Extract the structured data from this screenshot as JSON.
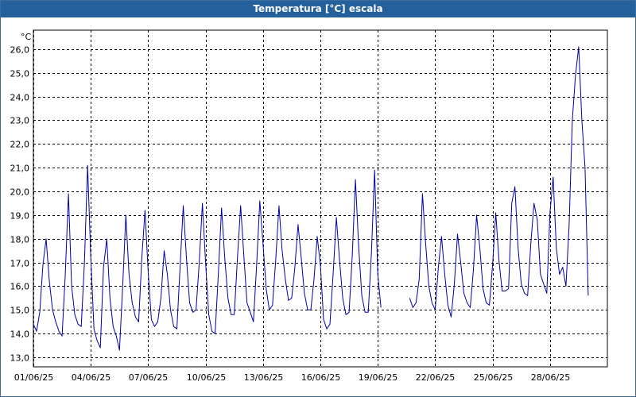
{
  "window": {
    "title": "Temperatura [°C] escala"
  },
  "colors": {
    "titlebar": "#24609b",
    "series": "#0000a8",
    "grid": "#000000"
  },
  "chart_data": {
    "type": "line",
    "title": "Temperatura [°C] escala",
    "ylabel": "°C",
    "xlabel": "",
    "ylim": [
      12.6,
      26.8
    ],
    "yticks": [
      "13,0",
      "14,0",
      "15,0",
      "16,0",
      "17,0",
      "18,0",
      "19,0",
      "20,0",
      "21,0",
      "22,0",
      "23,0",
      "24,0",
      "25,0",
      "26,0"
    ],
    "ytick_values": [
      13,
      14,
      15,
      16,
      17,
      18,
      19,
      20,
      21,
      22,
      23,
      24,
      25,
      26
    ],
    "xlim": [
      "2025-06-01",
      "2025-07-01"
    ],
    "xticks": [
      "01/06/25",
      "04/06/25",
      "07/06/25",
      "10/06/25",
      "13/06/25",
      "16/06/25",
      "19/06/25",
      "22/06/25",
      "25/06/25",
      "28/06/25"
    ],
    "xtick_dates": [
      "2025-06-01",
      "2025-06-04",
      "2025-06-07",
      "2025-06-10",
      "2025-06-13",
      "2025-06-16",
      "2025-06-19",
      "2025-06-22",
      "2025-06-25",
      "2025-06-28"
    ],
    "grid": true,
    "series": [
      {
        "x": [
          "2025-06-01 00:00",
          "2025-06-01 04:00",
          "2025-06-01 08:00",
          "2025-06-01 12:00",
          "2025-06-01 16:00",
          "2025-06-01 20:00",
          "2025-06-02 00:00",
          "2025-06-02 04:00",
          "2025-06-02 08:00",
          "2025-06-02 12:00",
          "2025-06-02 16:00",
          "2025-06-02 20:00",
          "2025-06-03 00:00",
          "2025-06-03 04:00",
          "2025-06-03 08:00",
          "2025-06-03 12:00",
          "2025-06-03 16:00",
          "2025-06-03 20:00",
          "2025-06-04 00:00",
          "2025-06-04 04:00",
          "2025-06-04 08:00",
          "2025-06-04 12:00",
          "2025-06-04 16:00",
          "2025-06-04 20:00",
          "2025-06-05 00:00",
          "2025-06-05 04:00",
          "2025-06-05 08:00",
          "2025-06-05 12:00",
          "2025-06-05 16:00",
          "2025-06-05 20:00",
          "2025-06-06 00:00",
          "2025-06-06 04:00",
          "2025-06-06 08:00",
          "2025-06-06 12:00",
          "2025-06-06 16:00",
          "2025-06-06 20:00",
          "2025-06-07 00:00",
          "2025-06-07 04:00",
          "2025-06-07 08:00",
          "2025-06-07 12:00",
          "2025-06-07 16:00",
          "2025-06-07 20:00",
          "2025-06-08 00:00",
          "2025-06-08 04:00",
          "2025-06-08 08:00",
          "2025-06-08 12:00",
          "2025-06-08 16:00",
          "2025-06-08 20:00",
          "2025-06-09 00:00",
          "2025-06-09 04:00",
          "2025-06-09 08:00",
          "2025-06-09 12:00",
          "2025-06-09 16:00",
          "2025-06-09 20:00",
          "2025-06-10 00:00",
          "2025-06-10 04:00",
          "2025-06-10 08:00",
          "2025-06-10 12:00",
          "2025-06-10 16:00",
          "2025-06-10 20:00",
          "2025-06-11 00:00",
          "2025-06-11 04:00",
          "2025-06-11 08:00",
          "2025-06-11 12:00",
          "2025-06-11 16:00",
          "2025-06-11 20:00",
          "2025-06-12 00:00",
          "2025-06-12 04:00",
          "2025-06-12 08:00",
          "2025-06-12 12:00",
          "2025-06-12 16:00",
          "2025-06-12 20:00",
          "2025-06-13 00:00",
          "2025-06-13 04:00",
          "2025-06-13 08:00",
          "2025-06-13 12:00",
          "2025-06-13 16:00",
          "2025-06-13 20:00",
          "2025-06-14 00:00",
          "2025-06-14 04:00",
          "2025-06-14 08:00",
          "2025-06-14 12:00",
          "2025-06-14 16:00",
          "2025-06-14 20:00",
          "2025-06-15 00:00",
          "2025-06-15 04:00",
          "2025-06-15 08:00",
          "2025-06-15 12:00",
          "2025-06-15 16:00",
          "2025-06-15 20:00",
          "2025-06-16 00:00",
          "2025-06-16 04:00",
          "2025-06-16 08:00",
          "2025-06-16 12:00",
          "2025-06-16 16:00",
          "2025-06-16 20:00",
          "2025-06-17 00:00",
          "2025-06-17 04:00",
          "2025-06-17 08:00",
          "2025-06-17 12:00",
          "2025-06-17 16:00",
          "2025-06-17 20:00",
          "2025-06-18 00:00",
          "2025-06-18 04:00",
          "2025-06-18 08:00",
          "2025-06-18 12:00",
          "2025-06-18 16:00",
          "2025-06-18 20:00",
          "2025-06-19 00:00",
          "2025-06-19 04:00",
          null,
          "2025-06-20 16:00",
          "2025-06-20 20:00",
          "2025-06-21 00:00",
          "2025-06-21 04:00",
          "2025-06-21 08:00",
          "2025-06-21 12:00",
          "2025-06-21 16:00",
          "2025-06-21 20:00",
          "2025-06-22 00:00",
          "2025-06-22 04:00",
          "2025-06-22 08:00",
          "2025-06-22 12:00",
          "2025-06-22 16:00",
          "2025-06-22 20:00",
          "2025-06-23 00:00",
          "2025-06-23 04:00",
          "2025-06-23 08:00",
          "2025-06-23 12:00",
          "2025-06-23 16:00",
          "2025-06-23 20:00",
          "2025-06-24 00:00",
          "2025-06-24 04:00",
          "2025-06-24 08:00",
          "2025-06-24 12:00",
          "2025-06-24 16:00",
          "2025-06-24 20:00",
          "2025-06-25 00:00",
          "2025-06-25 04:00",
          "2025-06-25 08:00",
          "2025-06-25 12:00",
          "2025-06-25 16:00",
          "2025-06-25 20:00",
          "2025-06-26 00:00",
          "2025-06-26 04:00",
          "2025-06-26 08:00",
          "2025-06-26 12:00",
          "2025-06-26 16:00",
          "2025-06-26 20:00",
          "2025-06-27 00:00",
          "2025-06-27 04:00",
          "2025-06-27 08:00",
          "2025-06-27 12:00",
          "2025-06-27 16:00",
          "2025-06-27 20:00",
          "2025-06-28 00:00",
          "2025-06-28 04:00",
          "2025-06-28 08:00",
          "2025-06-28 12:00",
          "2025-06-28 16:00",
          "2025-06-28 20:00",
          "2025-06-29 00:00",
          "2025-06-29 04:00",
          "2025-06-29 08:00",
          "2025-06-29 12:00",
          "2025-06-29 16:00",
          "2025-06-29 20:00",
          "2025-06-30 00:00"
        ],
        "y": [
          14.4,
          14.1,
          14.9,
          16.9,
          18.0,
          16.2,
          15.0,
          14.5,
          14.1,
          13.9,
          16.5,
          19.9,
          16.0,
          14.8,
          14.4,
          14.3,
          17.0,
          21.1,
          17.2,
          14.2,
          13.7,
          13.4,
          16.8,
          18.0,
          15.5,
          14.3,
          13.9,
          13.3,
          16.0,
          19.0,
          16.5,
          15.3,
          14.7,
          14.5,
          17.2,
          19.2,
          16.6,
          14.6,
          14.3,
          14.5,
          15.5,
          17.5,
          16.5,
          15.0,
          14.3,
          14.2,
          16.8,
          19.4,
          17.2,
          15.3,
          14.9,
          15.0,
          17.0,
          19.5,
          17.0,
          14.8,
          14.1,
          14.0,
          16.5,
          19.3,
          17.2,
          15.5,
          14.8,
          14.8,
          17.2,
          19.4,
          17.3,
          15.3,
          14.9,
          14.5,
          16.9,
          19.6,
          17.8,
          15.9,
          15.0,
          15.2,
          17.1,
          19.4,
          17.5,
          16.3,
          15.4,
          15.5,
          16.8,
          18.6,
          17.2,
          15.7,
          15.0,
          15.0,
          16.3,
          18.1,
          16.9,
          14.6,
          14.2,
          14.4,
          16.5,
          18.9,
          17.1,
          15.5,
          14.8,
          14.9,
          17.3,
          20.5,
          17.7,
          15.6,
          14.9,
          14.9,
          17.4,
          20.9,
          16.5,
          15.1,
          null,
          15.5,
          15.1,
          15.3,
          16.3,
          19.9,
          17.8,
          16.0,
          15.3,
          15.0,
          16.8,
          18.1,
          16.5,
          15.2,
          14.7,
          16.1,
          18.2,
          17.0,
          15.7,
          15.3,
          15.1,
          16.7,
          19.0,
          17.6,
          15.9,
          15.3,
          15.2,
          16.9,
          19.1,
          17.1,
          15.8,
          15.8,
          15.9,
          19.5,
          20.2,
          17.6,
          16.1,
          15.7,
          15.6,
          17.8,
          19.5,
          18.8,
          16.5,
          16.1,
          15.7,
          19.1,
          20.6,
          17.6,
          16.5,
          16.8,
          16.0,
          18.6,
          23.0,
          24.9,
          26.1,
          23.0,
          21.0,
          15.6
        ]
      }
    ]
  }
}
